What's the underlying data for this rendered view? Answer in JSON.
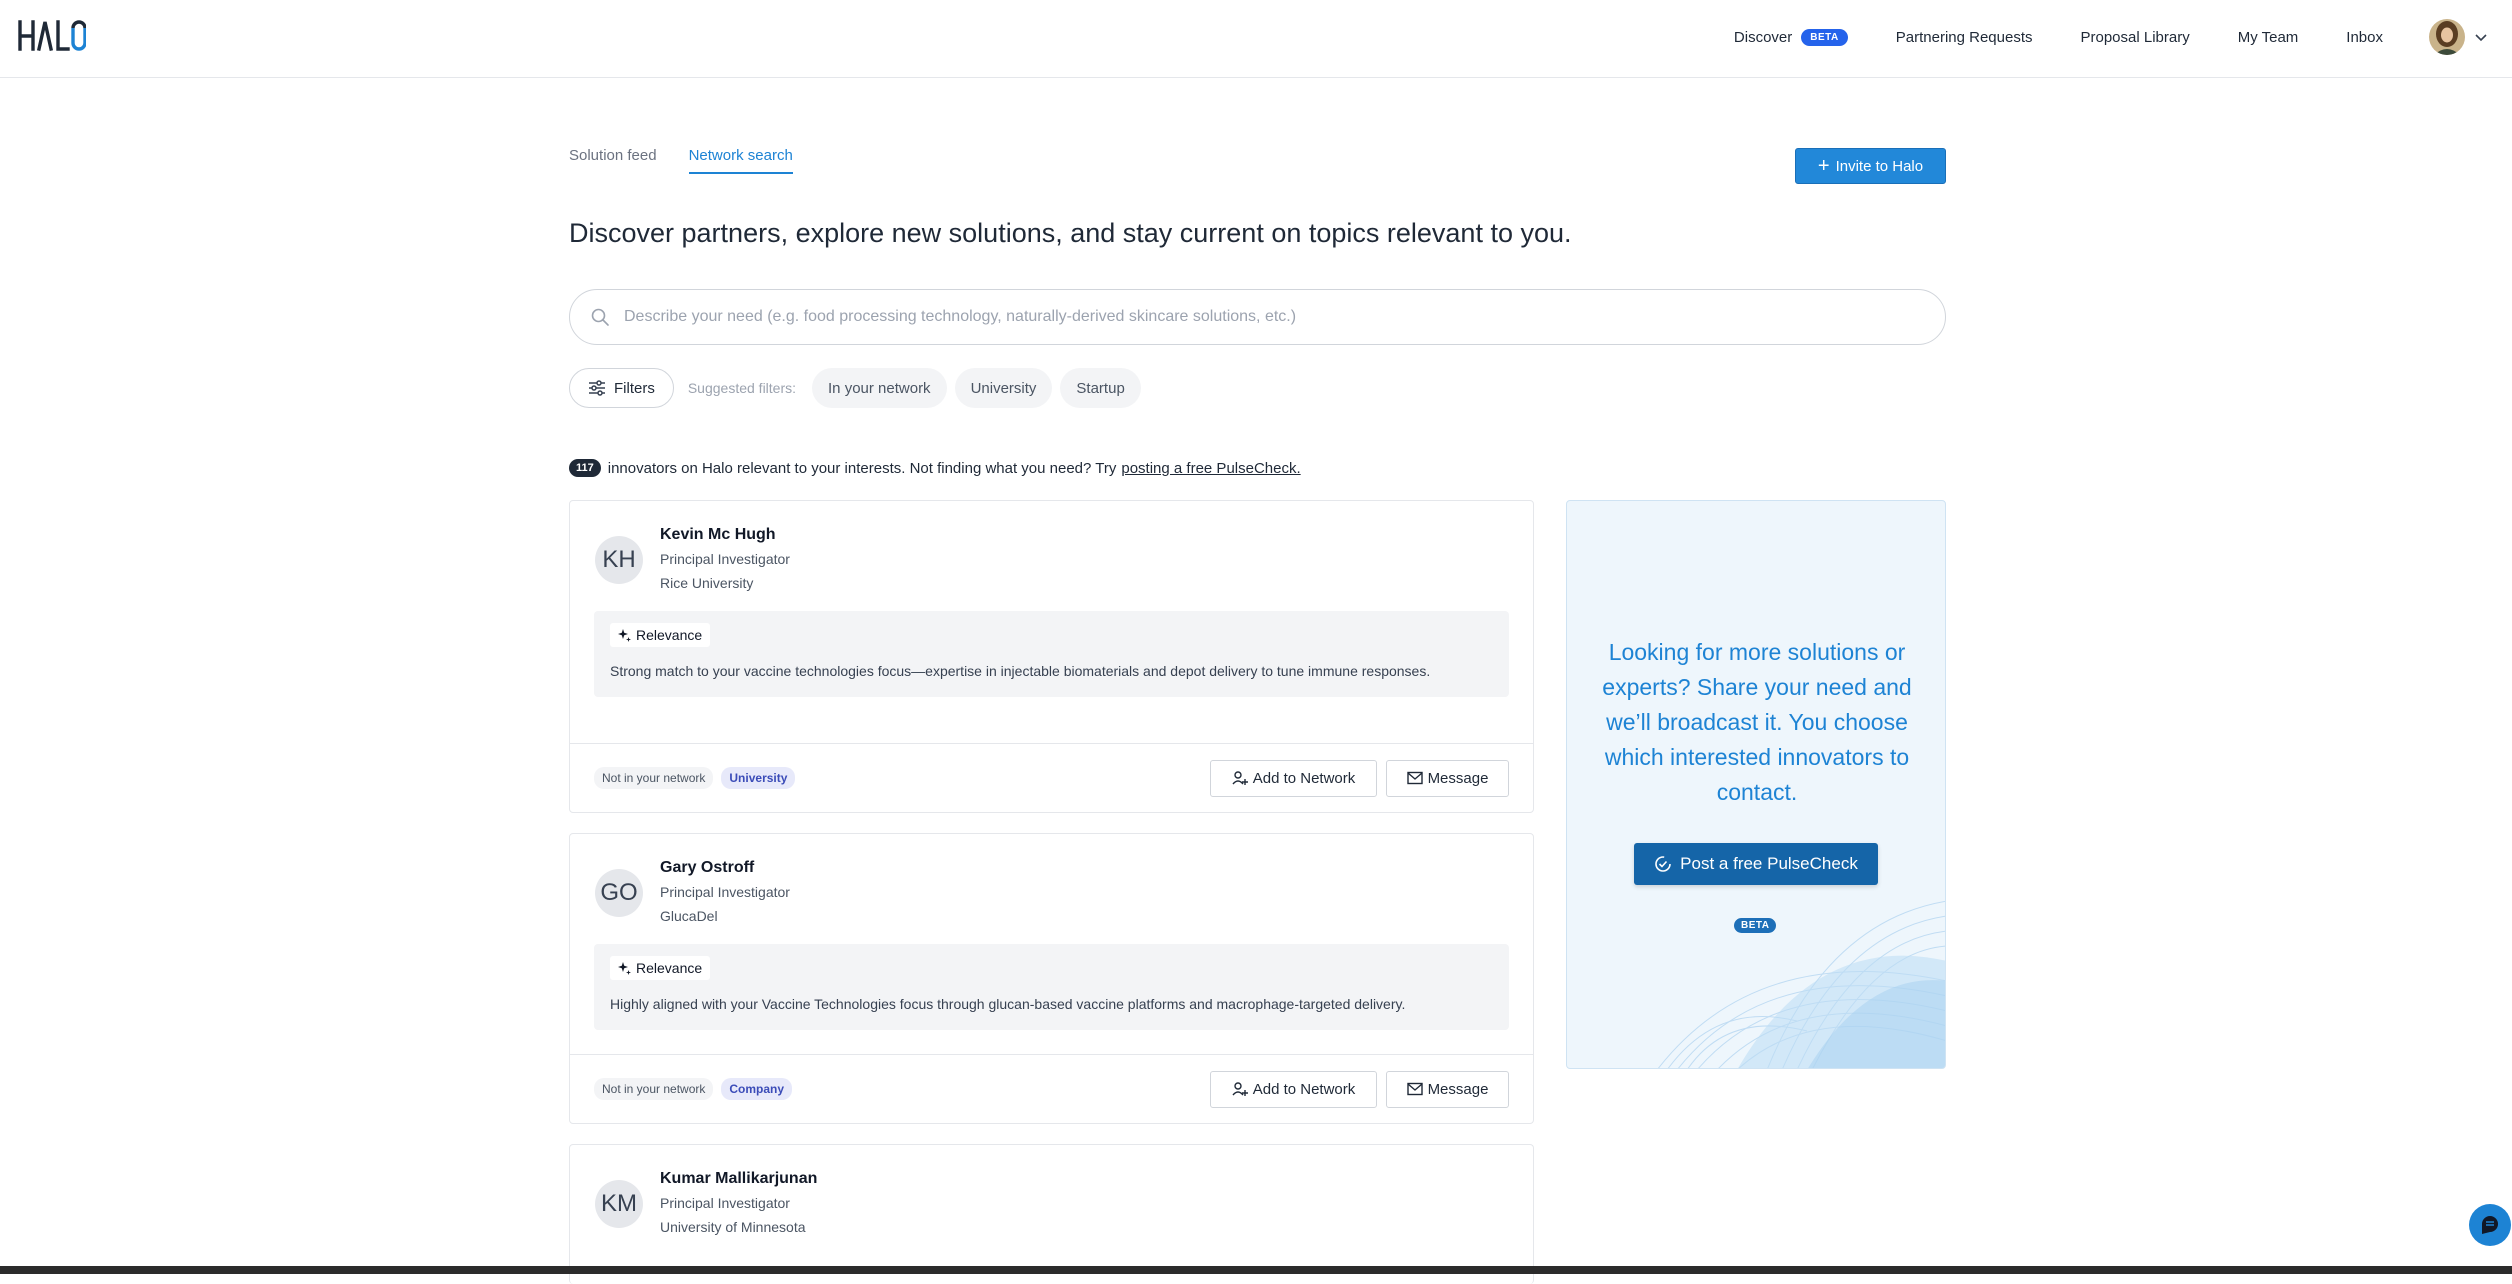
{
  "header": {
    "logo_text": "HALO",
    "nav": [
      {
        "label": "Discover",
        "badge": "BETA"
      },
      {
        "label": "Partnering Requests"
      },
      {
        "label": "Proposal Library"
      },
      {
        "label": "My Team"
      },
      {
        "label": "Inbox"
      }
    ],
    "avatar_icon": "user-avatar",
    "menu_icon": "chevron-down-icon"
  },
  "tabs": [
    {
      "label": "Solution feed",
      "active": false
    },
    {
      "label": "Network search",
      "active": true
    }
  ],
  "invite_button": {
    "label": "Invite to Halo",
    "icon": "plus-icon"
  },
  "headline": "Discover partners, explore new solutions, and stay current on topics relevant to you.",
  "search": {
    "placeholder": "Describe your need (e.g. food processing technology, naturally-derived skincare solutions, etc.)",
    "value": "",
    "icon": "search-icon"
  },
  "filters": {
    "button_label": "Filters",
    "suggested_label": "Suggested filters:",
    "chips": [
      "In your network",
      "University",
      "Startup"
    ]
  },
  "results": {
    "count": "117",
    "text": "innovators on Halo relevant to your interests. Not finding what you need? Try",
    "link_text": "posting a free PulseCheck."
  },
  "cards": [
    {
      "initials": "KH",
      "name": "Kevin Mc Hugh",
      "role": "Principal Investigator",
      "org": "Rice University",
      "relevance_label": "Relevance",
      "relevance_text": "Strong match to your vaccine technologies focus—expertise in injectable biomaterials and depot delivery to tune immune responses.",
      "network_status": "Not in your network",
      "type": "University",
      "add_label": "Add to Network",
      "message_label": "Message"
    },
    {
      "initials": "GO",
      "name": "Gary Ostroff",
      "role": "Principal Investigator",
      "org": "GlucaDel",
      "relevance_label": "Relevance",
      "relevance_text": "Highly aligned with your Vaccine Technologies focus through glucan-based vaccine platforms and macrophage-targeted delivery.",
      "network_status": "Not in your network",
      "type": "Company",
      "add_label": "Add to Network",
      "message_label": "Message"
    },
    {
      "initials": "KM",
      "name": "Kumar Mallikarjunan",
      "role": "Principal Investigator",
      "org": "University of Minnesota"
    }
  ],
  "promo": {
    "text": "Looking for more solutions or experts? Share your need and we’ll broadcast it. You choose which interested innovators to contact.",
    "button_label": "Post a free PulseCheck",
    "badge": "BETA"
  },
  "colors": {
    "accent": "#1d83d4",
    "primary_button": "#2288d9",
    "pulse_button": "#1565a8",
    "beta_badge": "#2563eb"
  }
}
